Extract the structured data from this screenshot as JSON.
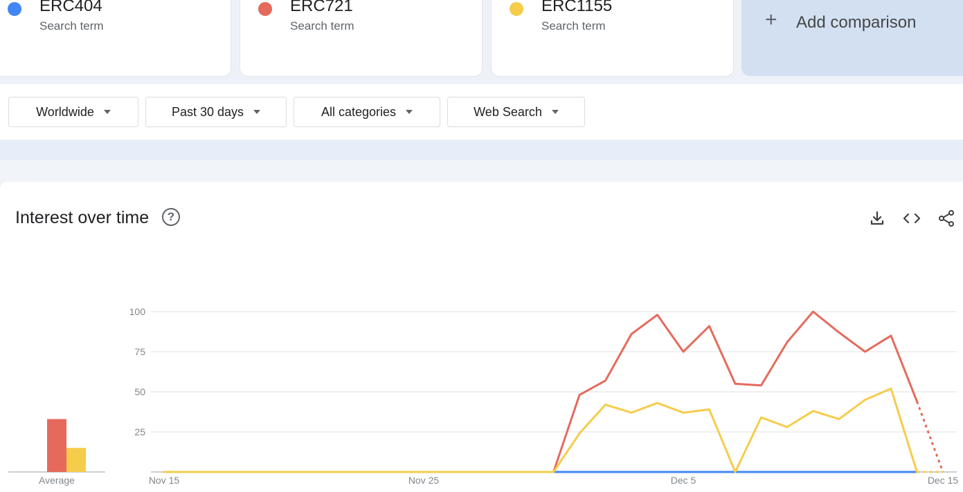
{
  "terms": [
    {
      "name": "ERC404",
      "sub": "Search term",
      "color": "#4285f4"
    },
    {
      "name": "ERC721",
      "sub": "Search term",
      "color": "#e56a5c"
    },
    {
      "name": "ERC1155",
      "sub": "Search term",
      "color": "#f6cc4b"
    }
  ],
  "add_comparison": {
    "icon": "plus-icon",
    "label": "Add comparison"
  },
  "filters": {
    "region": "Worldwide",
    "time": "Past 30 days",
    "category": "All categories",
    "source": "Web Search"
  },
  "panel": {
    "title": "Interest over time",
    "help_icon": "help-circle-icon",
    "help_glyph": "?",
    "tools": [
      "download-icon",
      "embed-code-icon",
      "share-icon"
    ]
  },
  "chart_data": {
    "type": "line",
    "x_labels": [
      "Nov 15",
      "Nov 25",
      "Dec 5",
      "Dec 15"
    ],
    "y_ticks": [
      25,
      50,
      75,
      100
    ],
    "ylim": [
      0,
      100
    ],
    "grid": true,
    "legend": "none",
    "x": [
      "Nov 15",
      "Nov 16",
      "Nov 17",
      "Nov 18",
      "Nov 19",
      "Nov 20",
      "Nov 21",
      "Nov 22",
      "Nov 23",
      "Nov 24",
      "Nov 25",
      "Nov 26",
      "Nov 27",
      "Nov 28",
      "Nov 29",
      "Nov 30",
      "Dec 1",
      "Dec 2",
      "Dec 3",
      "Dec 4",
      "Dec 5",
      "Dec 6",
      "Dec 7",
      "Dec 8",
      "Dec 9",
      "Dec 10",
      "Dec 11",
      "Dec 12",
      "Dec 13",
      "Dec 14",
      "Dec 15"
    ],
    "partial_from": "Dec 14",
    "series": [
      {
        "name": "ERC404",
        "color": "#4285f4",
        "values": [
          0,
          0,
          0,
          0,
          0,
          0,
          0,
          0,
          0,
          0,
          0,
          0,
          0,
          0,
          0,
          0,
          0,
          0,
          0,
          0,
          0,
          0,
          0,
          0,
          0,
          0,
          0,
          0,
          0,
          0,
          0
        ]
      },
      {
        "name": "ERC721",
        "color": "#e56a5c",
        "values": [
          0,
          0,
          0,
          0,
          0,
          0,
          0,
          0,
          0,
          0,
          0,
          0,
          0,
          0,
          0,
          0,
          48,
          57,
          86,
          98,
          75,
          91,
          55,
          54,
          81,
          100,
          87,
          75,
          85,
          44,
          0
        ]
      },
      {
        "name": "ERC1155",
        "color": "#f6cc4b",
        "values": [
          0,
          0,
          0,
          0,
          0,
          0,
          0,
          0,
          0,
          0,
          0,
          0,
          0,
          0,
          0,
          0,
          24,
          42,
          37,
          43,
          37,
          39,
          0,
          34,
          28,
          38,
          33,
          45,
          52,
          0,
          0
        ]
      }
    ],
    "average": {
      "label": "Average",
      "values": [
        {
          "name": "ERC404",
          "value": 0,
          "color": "#4285f4"
        },
        {
          "name": "ERC721",
          "value": 33,
          "color": "#e56a5c"
        },
        {
          "name": "ERC1155",
          "value": 15,
          "color": "#f6cc4b"
        }
      ]
    }
  }
}
